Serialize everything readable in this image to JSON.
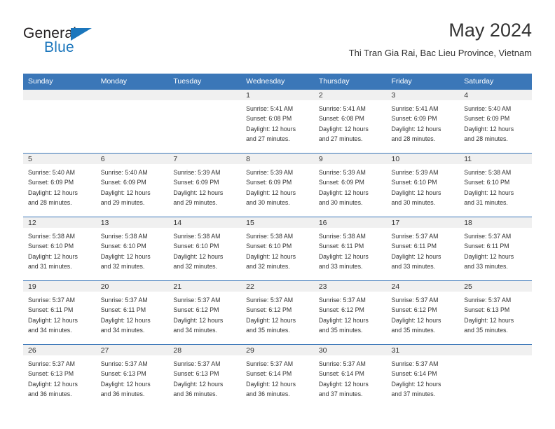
{
  "brand": {
    "word_one": "General",
    "word_two": "Blue",
    "triangle_icon": "brand-triangle-icon",
    "accent_color": "#1b76bc"
  },
  "header": {
    "title": "May 2024",
    "subtitle": "Thi Tran Gia Rai, Bac Lieu Province, Vietnam"
  },
  "calendar": {
    "header_bg": "#3b77b8",
    "daynum_bg": "#f0f0f0",
    "weekday_names": [
      "Sunday",
      "Monday",
      "Tuesday",
      "Wednesday",
      "Thursday",
      "Friday",
      "Saturday"
    ],
    "weeks": [
      [
        {
          "day": "",
          "empty": true,
          "sunrise": "",
          "sunset": "",
          "daylight_line1": "",
          "daylight_line2": ""
        },
        {
          "day": "",
          "empty": true,
          "sunrise": "",
          "sunset": "",
          "daylight_line1": "",
          "daylight_line2": ""
        },
        {
          "day": "",
          "empty": true,
          "sunrise": "",
          "sunset": "",
          "daylight_line1": "",
          "daylight_line2": ""
        },
        {
          "day": "1",
          "empty": false,
          "sunrise": "Sunrise: 5:41 AM",
          "sunset": "Sunset: 6:08 PM",
          "daylight_line1": "Daylight: 12 hours",
          "daylight_line2": "and 27 minutes."
        },
        {
          "day": "2",
          "empty": false,
          "sunrise": "Sunrise: 5:41 AM",
          "sunset": "Sunset: 6:08 PM",
          "daylight_line1": "Daylight: 12 hours",
          "daylight_line2": "and 27 minutes."
        },
        {
          "day": "3",
          "empty": false,
          "sunrise": "Sunrise: 5:41 AM",
          "sunset": "Sunset: 6:09 PM",
          "daylight_line1": "Daylight: 12 hours",
          "daylight_line2": "and 28 minutes."
        },
        {
          "day": "4",
          "empty": false,
          "sunrise": "Sunrise: 5:40 AM",
          "sunset": "Sunset: 6:09 PM",
          "daylight_line1": "Daylight: 12 hours",
          "daylight_line2": "and 28 minutes."
        }
      ],
      [
        {
          "day": "5",
          "empty": false,
          "sunrise": "Sunrise: 5:40 AM",
          "sunset": "Sunset: 6:09 PM",
          "daylight_line1": "Daylight: 12 hours",
          "daylight_line2": "and 28 minutes."
        },
        {
          "day": "6",
          "empty": false,
          "sunrise": "Sunrise: 5:40 AM",
          "sunset": "Sunset: 6:09 PM",
          "daylight_line1": "Daylight: 12 hours",
          "daylight_line2": "and 29 minutes."
        },
        {
          "day": "7",
          "empty": false,
          "sunrise": "Sunrise: 5:39 AM",
          "sunset": "Sunset: 6:09 PM",
          "daylight_line1": "Daylight: 12 hours",
          "daylight_line2": "and 29 minutes."
        },
        {
          "day": "8",
          "empty": false,
          "sunrise": "Sunrise: 5:39 AM",
          "sunset": "Sunset: 6:09 PM",
          "daylight_line1": "Daylight: 12 hours",
          "daylight_line2": "and 30 minutes."
        },
        {
          "day": "9",
          "empty": false,
          "sunrise": "Sunrise: 5:39 AM",
          "sunset": "Sunset: 6:09 PM",
          "daylight_line1": "Daylight: 12 hours",
          "daylight_line2": "and 30 minutes."
        },
        {
          "day": "10",
          "empty": false,
          "sunrise": "Sunrise: 5:39 AM",
          "sunset": "Sunset: 6:10 PM",
          "daylight_line1": "Daylight: 12 hours",
          "daylight_line2": "and 30 minutes."
        },
        {
          "day": "11",
          "empty": false,
          "sunrise": "Sunrise: 5:38 AM",
          "sunset": "Sunset: 6:10 PM",
          "daylight_line1": "Daylight: 12 hours",
          "daylight_line2": "and 31 minutes."
        }
      ],
      [
        {
          "day": "12",
          "empty": false,
          "sunrise": "Sunrise: 5:38 AM",
          "sunset": "Sunset: 6:10 PM",
          "daylight_line1": "Daylight: 12 hours",
          "daylight_line2": "and 31 minutes."
        },
        {
          "day": "13",
          "empty": false,
          "sunrise": "Sunrise: 5:38 AM",
          "sunset": "Sunset: 6:10 PM",
          "daylight_line1": "Daylight: 12 hours",
          "daylight_line2": "and 32 minutes."
        },
        {
          "day": "14",
          "empty": false,
          "sunrise": "Sunrise: 5:38 AM",
          "sunset": "Sunset: 6:10 PM",
          "daylight_line1": "Daylight: 12 hours",
          "daylight_line2": "and 32 minutes."
        },
        {
          "day": "15",
          "empty": false,
          "sunrise": "Sunrise: 5:38 AM",
          "sunset": "Sunset: 6:10 PM",
          "daylight_line1": "Daylight: 12 hours",
          "daylight_line2": "and 32 minutes."
        },
        {
          "day": "16",
          "empty": false,
          "sunrise": "Sunrise: 5:38 AM",
          "sunset": "Sunset: 6:11 PM",
          "daylight_line1": "Daylight: 12 hours",
          "daylight_line2": "and 33 minutes."
        },
        {
          "day": "17",
          "empty": false,
          "sunrise": "Sunrise: 5:37 AM",
          "sunset": "Sunset: 6:11 PM",
          "daylight_line1": "Daylight: 12 hours",
          "daylight_line2": "and 33 minutes."
        },
        {
          "day": "18",
          "empty": false,
          "sunrise": "Sunrise: 5:37 AM",
          "sunset": "Sunset: 6:11 PM",
          "daylight_line1": "Daylight: 12 hours",
          "daylight_line2": "and 33 minutes."
        }
      ],
      [
        {
          "day": "19",
          "empty": false,
          "sunrise": "Sunrise: 5:37 AM",
          "sunset": "Sunset: 6:11 PM",
          "daylight_line1": "Daylight: 12 hours",
          "daylight_line2": "and 34 minutes."
        },
        {
          "day": "20",
          "empty": false,
          "sunrise": "Sunrise: 5:37 AM",
          "sunset": "Sunset: 6:11 PM",
          "daylight_line1": "Daylight: 12 hours",
          "daylight_line2": "and 34 minutes."
        },
        {
          "day": "21",
          "empty": false,
          "sunrise": "Sunrise: 5:37 AM",
          "sunset": "Sunset: 6:12 PM",
          "daylight_line1": "Daylight: 12 hours",
          "daylight_line2": "and 34 minutes."
        },
        {
          "day": "22",
          "empty": false,
          "sunrise": "Sunrise: 5:37 AM",
          "sunset": "Sunset: 6:12 PM",
          "daylight_line1": "Daylight: 12 hours",
          "daylight_line2": "and 35 minutes."
        },
        {
          "day": "23",
          "empty": false,
          "sunrise": "Sunrise: 5:37 AM",
          "sunset": "Sunset: 6:12 PM",
          "daylight_line1": "Daylight: 12 hours",
          "daylight_line2": "and 35 minutes."
        },
        {
          "day": "24",
          "empty": false,
          "sunrise": "Sunrise: 5:37 AM",
          "sunset": "Sunset: 6:12 PM",
          "daylight_line1": "Daylight: 12 hours",
          "daylight_line2": "and 35 minutes."
        },
        {
          "day": "25",
          "empty": false,
          "sunrise": "Sunrise: 5:37 AM",
          "sunset": "Sunset: 6:13 PM",
          "daylight_line1": "Daylight: 12 hours",
          "daylight_line2": "and 35 minutes."
        }
      ],
      [
        {
          "day": "26",
          "empty": false,
          "sunrise": "Sunrise: 5:37 AM",
          "sunset": "Sunset: 6:13 PM",
          "daylight_line1": "Daylight: 12 hours",
          "daylight_line2": "and 36 minutes."
        },
        {
          "day": "27",
          "empty": false,
          "sunrise": "Sunrise: 5:37 AM",
          "sunset": "Sunset: 6:13 PM",
          "daylight_line1": "Daylight: 12 hours",
          "daylight_line2": "and 36 minutes."
        },
        {
          "day": "28",
          "empty": false,
          "sunrise": "Sunrise: 5:37 AM",
          "sunset": "Sunset: 6:13 PM",
          "daylight_line1": "Daylight: 12 hours",
          "daylight_line2": "and 36 minutes."
        },
        {
          "day": "29",
          "empty": false,
          "sunrise": "Sunrise: 5:37 AM",
          "sunset": "Sunset: 6:14 PM",
          "daylight_line1": "Daylight: 12 hours",
          "daylight_line2": "and 36 minutes."
        },
        {
          "day": "30",
          "empty": false,
          "sunrise": "Sunrise: 5:37 AM",
          "sunset": "Sunset: 6:14 PM",
          "daylight_line1": "Daylight: 12 hours",
          "daylight_line2": "and 37 minutes."
        },
        {
          "day": "31",
          "empty": false,
          "sunrise": "Sunrise: 5:37 AM",
          "sunset": "Sunset: 6:14 PM",
          "daylight_line1": "Daylight: 12 hours",
          "daylight_line2": "and 37 minutes."
        },
        {
          "day": "",
          "empty": true,
          "sunrise": "",
          "sunset": "",
          "daylight_line1": "",
          "daylight_line2": ""
        }
      ]
    ]
  }
}
